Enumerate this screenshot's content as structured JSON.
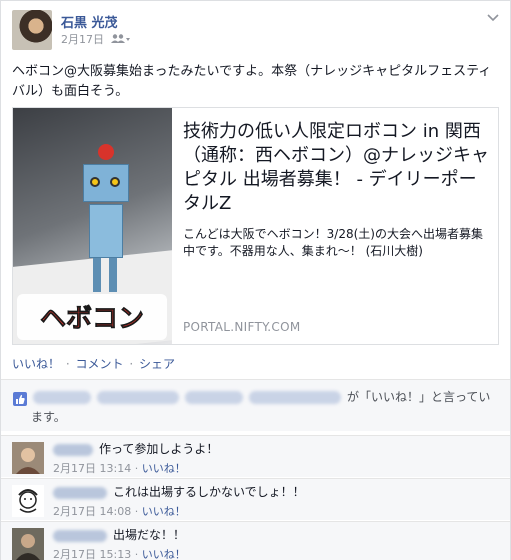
{
  "post": {
    "author": "石黒 光茂",
    "date": "2月17日",
    "audience_icon": "friends-icon",
    "text": "ヘボコン@大阪募集始まったみたいですよ。本祭（ナレッジキャピタルフェスティバル）も面白そう。"
  },
  "link": {
    "title": "技術力の低い人限定ロボコン in 関西（通称：西ヘボコン）@ナレッジキャピタル 出場者募集！ - デイリーポータルZ",
    "description": "こんどは大阪でヘボコン！3/28(土)の大会へ出場者募集中です。不器用な人、集まれ～！ (石川大樹)",
    "domain": "PORTAL.NIFTY.COM",
    "logo_text": "ヘボコン"
  },
  "actions": {
    "like": "いいね！",
    "comment": "コメント",
    "share": "シェア",
    "sep": "·"
  },
  "likes": {
    "suffix_line1": "が「いいね！」と言ってい",
    "suffix_line2": "ます。"
  },
  "comments": [
    {
      "text": "作って参加しようよ！",
      "date": "2月17日 13:14",
      "like": "いいね！"
    },
    {
      "text": "これは出場するしかないでしょ！！",
      "date": "2月17日 14:08",
      "like": "いいね！"
    },
    {
      "text": "出場だな！！",
      "date": "2月17日 15:13",
      "like": "いいね！"
    }
  ],
  "colors": {
    "link_blue": "#3b5998",
    "meta_gray": "#90949c",
    "bar_bg": "#f6f7f9"
  }
}
